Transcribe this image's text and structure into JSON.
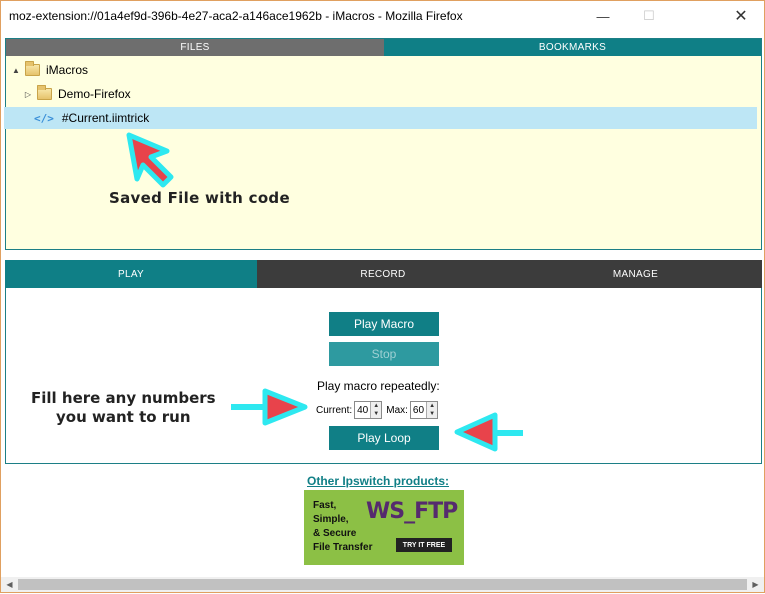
{
  "window": {
    "title": "moz-extension://01a4ef9d-396b-4e27-aca2-a146ace1962b - iMacros - Mozilla Firefox",
    "minimize": "—",
    "maximize": "☐",
    "close": "✕"
  },
  "top_tabs": {
    "files": "FILES",
    "bookmarks": "BOOKMARKS"
  },
  "tree": {
    "root": "iMacros",
    "folder": "Demo-Firefox",
    "selected_file": "#Current.iimtrick",
    "code_icon": "</>"
  },
  "annotations": {
    "saved": "Saved File with code",
    "fill_line1": "Fill here any numbers",
    "fill_line2": "you want to run"
  },
  "bottom_tabs": {
    "play": "PLAY",
    "record": "RECORD",
    "manage": "MANAGE"
  },
  "play": {
    "play_macro": "Play Macro",
    "stop": "Stop",
    "repeat_label": "Play macro repeatedly:",
    "current_label": "Current:",
    "current_value": "40",
    "max_label": "Max:",
    "max_value": "60",
    "play_loop": "Play Loop"
  },
  "promo": {
    "link": "Other Ipswitch products:",
    "line1": "Fast,",
    "line2": "Simple,",
    "line3": "& Secure",
    "line4": "File Transfer",
    "logo": "WS_FTP",
    "cta": "TRY IT FREE"
  },
  "colors": {
    "accent": "#107f86",
    "dark_tab": "#3c3c3c",
    "files_panel_bg": "#ffffe0",
    "selection": "#bde6f5",
    "arrow_fill": "#e8434b",
    "arrow_outline": "#2ee8f0",
    "ad_green": "#8cc045"
  },
  "icons": {
    "expanded": "▲",
    "collapsed": "▷",
    "scroll_left": "◀",
    "scroll_right": "▶",
    "spin_up": "▲",
    "spin_down": "▼"
  }
}
